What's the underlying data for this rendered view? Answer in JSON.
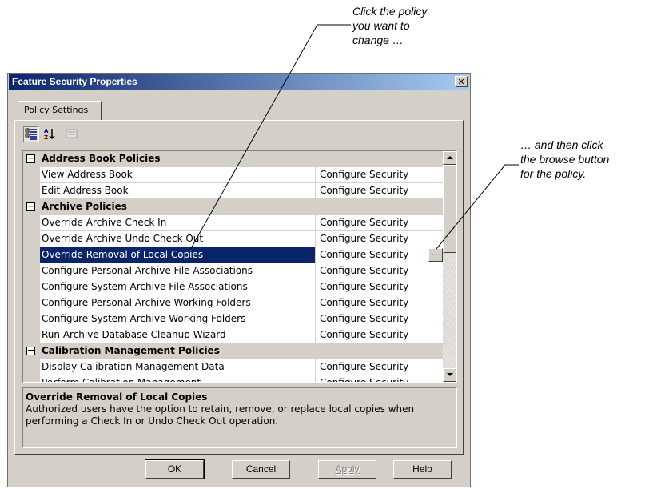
{
  "callouts": {
    "first": [
      "Click the policy",
      "you want to",
      "change …"
    ],
    "second": [
      "… and then click",
      "the browse button",
      "for the policy."
    ]
  },
  "dialog": {
    "title": "Feature Security Properties",
    "close_glyph": "✕",
    "tab": "Policy Settings",
    "toolbar": [
      "categorized-icon",
      "alphabetical-icon",
      "property-pages-icon"
    ]
  },
  "grid": {
    "rows": [
      {
        "type": "category",
        "label": "Address Book Policies",
        "expander": "−"
      },
      {
        "type": "item",
        "label": "View Address Book",
        "value": "Configure Security"
      },
      {
        "type": "item",
        "label": "Edit Address Book",
        "value": "Configure Security"
      },
      {
        "type": "category",
        "label": "Archive Policies",
        "expander": "−"
      },
      {
        "type": "item",
        "label": "Override Archive Check In",
        "value": "Configure Security"
      },
      {
        "type": "item",
        "label": "Override Archive Undo Check Out",
        "value": "Configure Security"
      },
      {
        "type": "item",
        "label": "Override Removal of Local Copies",
        "value": "Configure Security",
        "selected": true
      },
      {
        "type": "item",
        "label": "Configure Personal Archive File Associations",
        "value": "Configure Security"
      },
      {
        "type": "item",
        "label": "Configure System Archive File Associations",
        "value": "Configure Security"
      },
      {
        "type": "item",
        "label": "Configure Personal Archive Working Folders",
        "value": "Configure Security"
      },
      {
        "type": "item",
        "label": "Configure System Archive Working Folders",
        "value": "Configure Security"
      },
      {
        "type": "item",
        "label": "Run Archive Database Cleanup Wizard",
        "value": "Configure Security"
      },
      {
        "type": "category",
        "label": "Calibration Management Policies",
        "expander": "−"
      },
      {
        "type": "item",
        "label": "Display Calibration Management Data",
        "value": "Configure Security"
      },
      {
        "type": "item",
        "label": "Perform Calibration Management",
        "value": "Configure Security"
      }
    ],
    "browse_label": "..."
  },
  "description": {
    "title": "Override Removal of Local Copies",
    "text": "Authorized users have the option to retain, remove, or replace local copies when performing a Check In or Undo Check Out operation."
  },
  "buttons": {
    "ok": "OK",
    "cancel": "Cancel",
    "apply": "Apply",
    "help": "Help"
  }
}
